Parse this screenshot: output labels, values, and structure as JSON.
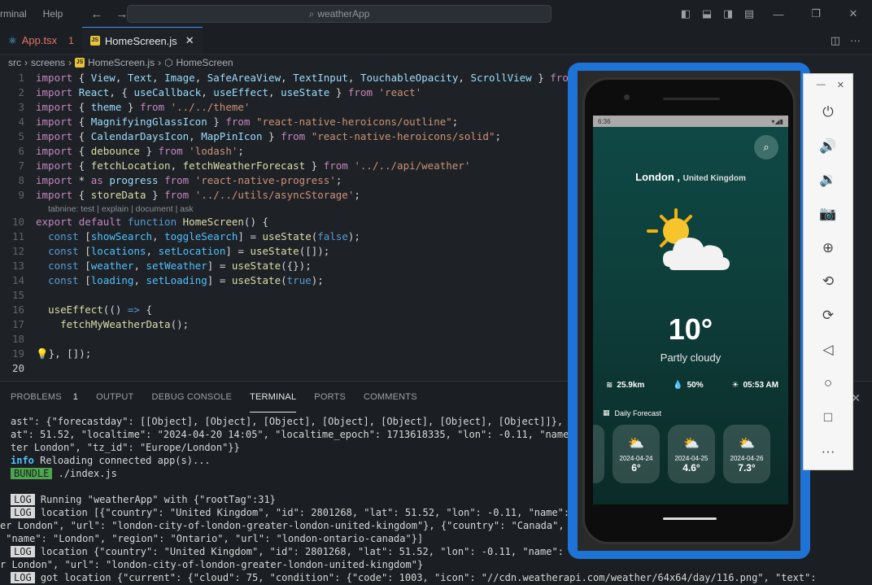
{
  "titlebar": {
    "menu": [
      "rminal",
      "Help"
    ],
    "search": "weatherApp"
  },
  "tabs": [
    {
      "label": "App.tsx",
      "badge": "1"
    },
    {
      "label": "HomeScreen.js"
    }
  ],
  "breadcrumb": {
    "parts": [
      "src",
      "screens",
      "HomeScreen.js",
      "HomeScreen"
    ]
  },
  "editor": {
    "codelens": "tabnine: test | explain | document | ask"
  },
  "panel": {
    "tabs": [
      "PROBLEMS",
      "OUTPUT",
      "DEBUG CONSOLE",
      "TERMINAL",
      "PORTS",
      "COMMENTS"
    ],
    "problems_count": "1",
    "terminal_lines": [
      "ast\": {\"forecastday\": [[Object], [Object], [Object], [Object], [Object], [Object], [Object]]}, \"locatio",
      "at\": 51.52, \"localtime\": \"2024-04-20 14:05\", \"localtime_epoch\": 1713618335, \"lon\": -0.11, \"name\": \"Londo",
      "ter London\", \"tz_id\": \"Europe/London\"}}",
      "Reloading connected app(s)...",
      "./index.js",
      "",
      "Running \"weatherApp\" with {\"rootTag\":31}",
      "location [{\"country\": \"United Kingdom\", \"id\": 2801268, \"lat\": 51.52, \"lon\": -0.11, \"name\": \"Londo",
      "er London\", \"url\": \"london-city-of-london-greater-london-united-kingdom\"}, {\"country\": \"Canada\", \"id\":",
      " \"name\": \"London\", \"region\": \"Ontario\", \"url\": \"london-ontario-canada\"}]",
      "location {\"country\": \"United Kingdom\", \"id\": 2801268, \"lat\": 51.52, \"lon\": -0.11, \"name\": \"London",
      "r London\", \"url\": \"london-city-of-london-greater-london-united-kingdom\"}",
      "got location {\"current\": {\"cloud\": 75, \"condition\": {\"code\": 1003, \"icon\": \"//cdn.weatherapi.com/weather/64x64/day/116.png\", \"text\":"
    ],
    "tag_info": "info",
    "tag_bundle": "BUNDLE",
    "tag_log": "LOG"
  },
  "app": {
    "status_time": "6:36",
    "city": "London ,",
    "country": "United Kingdom",
    "temp": "10°",
    "condition": "Partly cloudy",
    "wind": "25.9km",
    "humidity": "50%",
    "sunrise": "05:53 AM",
    "daily_label": "Daily Forecast",
    "forecast": [
      {
        "date": "2024-04-24",
        "temp": "6°"
      },
      {
        "date": "2024-04-25",
        "temp": "4.6°"
      },
      {
        "date": "2024-04-26",
        "temp": "7.3°"
      }
    ]
  }
}
